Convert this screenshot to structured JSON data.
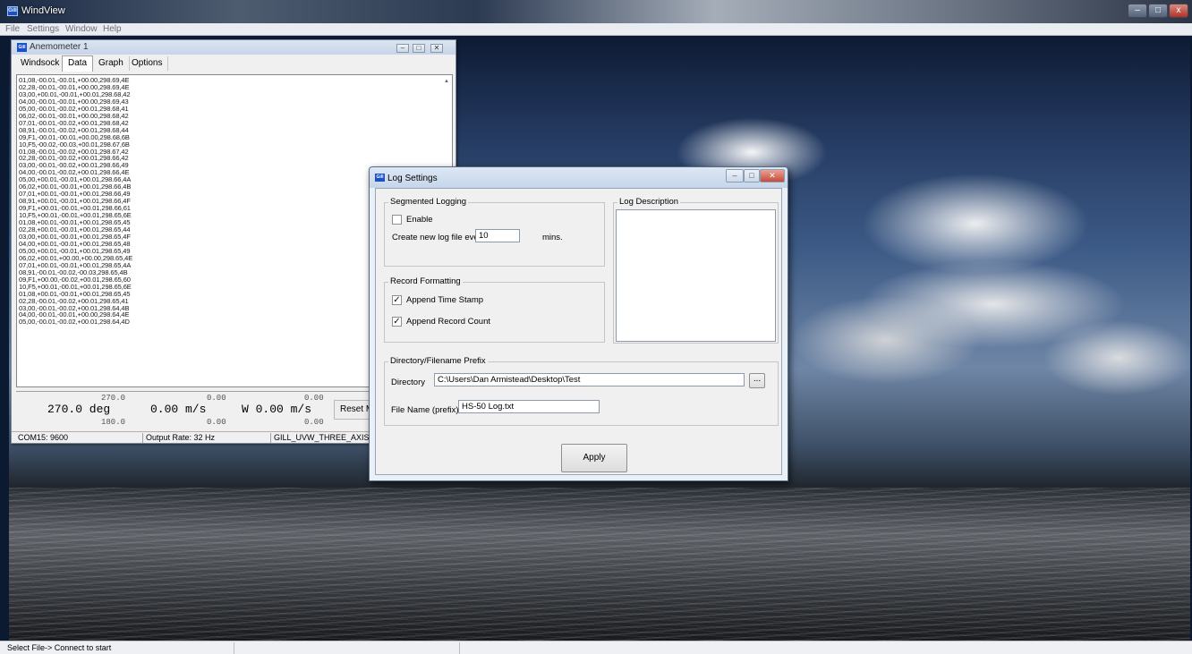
{
  "app": {
    "title": "WindView",
    "logo_text": "Gill",
    "menus": [
      "File",
      "Settings",
      "Window",
      "Help"
    ],
    "status_text": "Select File-> Connect to start",
    "controls": {
      "min": "–",
      "max": "□",
      "close": "x"
    }
  },
  "anemometer": {
    "title": "Anemometer 1",
    "window_buttons": {
      "min": "–",
      "restore": "□",
      "close": "✕"
    },
    "tabs": [
      "Windsock",
      "Data",
      "Graph",
      "Options"
    ],
    "active_tab": "Data",
    "data_lines": [
      "01,08,-00.01,-00.01,+00.00,298.69,4E",
      "02,28,-00.01,-00.01,+00.00,298.69,4E",
      "03,00,+00.01,-00.01,+00.01,298.68,42",
      "04,00,-00.01,-00.01,+00.00,298.69,43",
      "05,00,-00.01,-00.02,+00.01,298.68,41",
      "06,02,-00.01,-00.01,+00.00,298.68,42",
      "07,01,-00.01,-00.02,+00.01,298.68,42",
      "08,91,-00.01,-00.02,+00.01,298.68,44",
      "09,F1,-00.01,-00.01,+00.00,298.68,6B",
      "10,F5,-00.02,-00.03,+00.01,298.67,6B",
      "01,08,-00.01,-00.02,+00.01,298.67,42",
      "02,28,-00.01,-00.02,+00.01,298.66,42",
      "03,00,-00.01,-00.02,+00.01,298.66,49",
      "04,00,-00.01,-00.02,+00.01,298.66,4E",
      "05,00,+00.01,-00.01,+00.01,298.66,4A",
      "06,02,+00.01,-00.01,+00.01,298.66,4B",
      "07,01,+00.01,-00.01,+00.01,298.66,49",
      "08,91,+00.01,-00.01,+00.01,298.66,4F",
      "09,F1,+00.01,-00.01,+00.01,298.66,61",
      "10,F5,+00.01,-00.01,+00.01,298.65,6E",
      "01,08,+00.01,-00.01,+00.01,298.65,45",
      "02,28,+00.01,-00.01,+00.01,298.65,44",
      "03,00,+00.01,-00.01,+00.01,298.65,4F",
      "04,00,+00.01,-00.01,+00.01,298.65,48",
      "05,00,+00.01,-00.01,+00.01,298.65,49",
      "06,02,+00.01,+00.00,+00.00,298.65,4E",
      "07,01,+00.01,-00.01,+00.01,298.65,4A",
      "08,91,-00.01,-00.02,-00.03,298.65,4B",
      "09,F1,+00.00,-00.02,+00.01,298.65,60",
      "10,F5,+00.01,-00.01,+00.01,298.65,6E",
      "01,08,+00.01,-00.01,+00.01,298.65,45",
      "02,28,-00.01,-00.02,+00.01,298.65,41",
      "03,00,-00.01,-00.02,+00.01,298.64,4B",
      "04,00,-00.01,-00.01,+00.00,298.64,4E",
      "05,00,-00.01,-00.02,+00.01,298.64,4D"
    ],
    "readouts": {
      "direction": {
        "top": "270.0",
        "value": "270.0 deg",
        "bottom": "180.0"
      },
      "speed": {
        "top": "0.00",
        "value": "0.00 m/s",
        "bottom": "0.00"
      },
      "component": {
        "top": "0.00",
        "value": "W 0.00 m/s",
        "bottom": "0.00"
      }
    },
    "reset_label": "Reset Max",
    "status": {
      "port": "COM15: 9600",
      "rate": "Output Rate: 32 Hz",
      "mode": "GILL_UVW_THREE_AXIS"
    }
  },
  "log_settings": {
    "title": "Log Settings",
    "window_buttons": {
      "min": "–",
      "max": "□",
      "close": "✕"
    },
    "segmented": {
      "group_label": "Segmented Logging",
      "enable_label": "Enable",
      "enable_checked": false,
      "interval_label": "Create new log file every",
      "interval_value": "10",
      "interval_unit": "mins."
    },
    "formatting": {
      "group_label": "Record Formatting",
      "timestamp_label": "Append Time Stamp",
      "timestamp_checked": true,
      "count_label": "Append Record Count",
      "count_checked": true
    },
    "description": {
      "group_label": "Log Description",
      "value": ""
    },
    "directory": {
      "group_label": "Directory/Filename Prefix",
      "directory_label": "Directory",
      "directory_value": "C:\\Users\\Dan Armistead\\Desktop\\Test",
      "browse_label": "...",
      "filename_label": "File Name (prefix)",
      "filename_value": "HS-50 Log.txt"
    },
    "apply_label": "Apply"
  }
}
